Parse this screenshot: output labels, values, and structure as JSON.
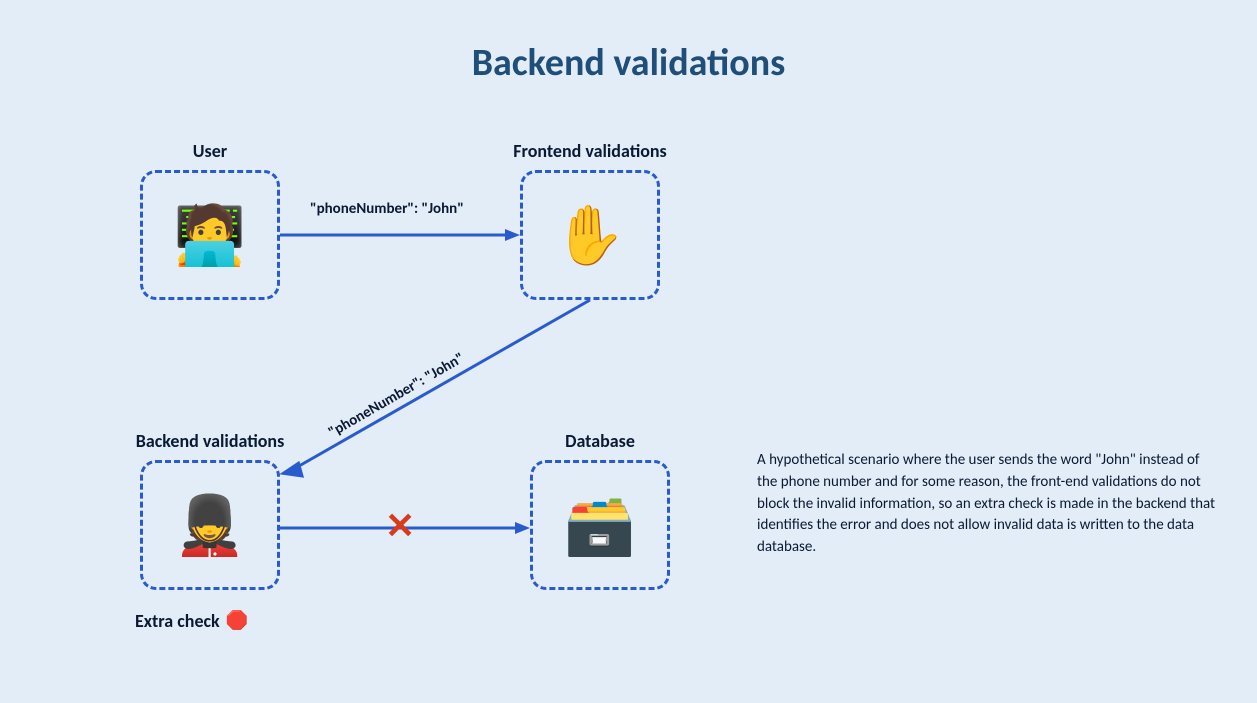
{
  "title": "Backend validations",
  "nodes": {
    "user": {
      "label": "User",
      "emoji": "🧑‍💻"
    },
    "frontend": {
      "label": "Frontend validations",
      "emoji": "✋"
    },
    "backend": {
      "label": "Backend validations",
      "emoji": "💂"
    },
    "database": {
      "label": "Database",
      "emoji": "🗃️"
    }
  },
  "edges": {
    "userToFrontend": {
      "label": "\"phoneNumber\": \"John\""
    },
    "frontendToBackend": {
      "label": "\"phoneNumber\": \"John\""
    },
    "backendToDatabase": {
      "blocked": true
    }
  },
  "extraCheck": {
    "label": "Extra check",
    "icon": "🛑"
  },
  "description": "A hypothetical scenario where the user sends the word \"John\" instead of the phone number and for some reason, the front-end validations do not block the invalid information, so an extra check is made in the backend that identifies the error and does not allow invalid data is written to the data database."
}
